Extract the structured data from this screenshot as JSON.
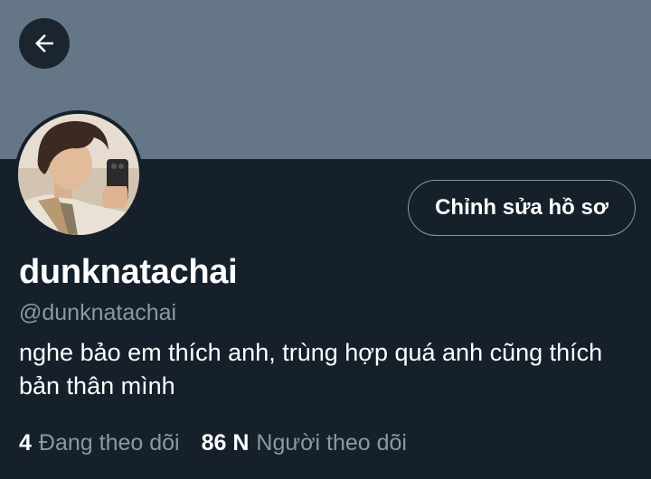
{
  "profile": {
    "display_name": "dunknatachai",
    "handle": "@dunknatachai",
    "bio": "nghe bảo em thích anh, trùng hợp quá anh cũng thích bản thân mình",
    "edit_button_label": "Chỉnh sửa hồ sơ"
  },
  "stats": {
    "following_count": "4",
    "following_label": "Đang theo dõi",
    "followers_count": "86 N",
    "followers_label": "Người theo dõi"
  },
  "icons": {
    "back": "arrow-left-icon"
  },
  "colors": {
    "background": "#15202b",
    "banner": "#657786",
    "secondary_text": "#8899a6",
    "primary_text": "#ffffff"
  }
}
